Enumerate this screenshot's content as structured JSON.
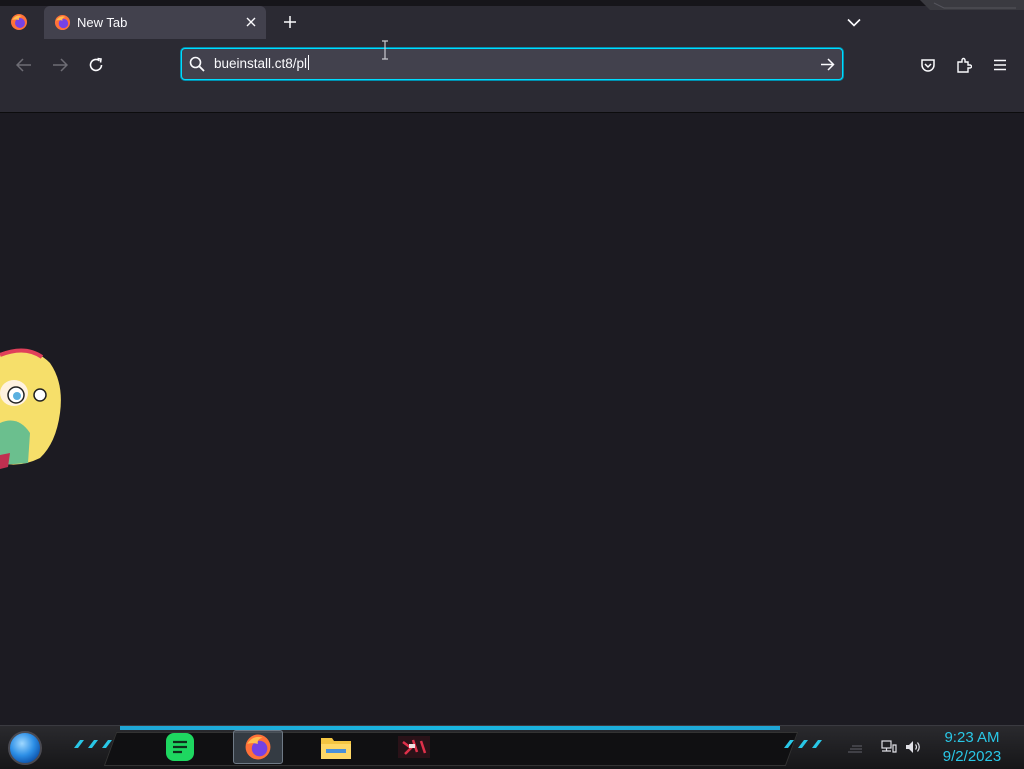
{
  "browser": {
    "tab_title": "New Tab",
    "url_value": "bueinstall.ct8/pl",
    "icons": {
      "firefox": "firefox-icon",
      "close": "close-icon",
      "new_tab": "plus-icon",
      "tab_list": "chevron-down-icon",
      "back": "arrow-left-icon",
      "forward": "arrow-right-icon",
      "reload": "reload-icon",
      "search": "search-icon",
      "go": "arrow-right-icon",
      "pocket": "pocket-icon",
      "extensions": "puzzle-icon",
      "menu": "hamburger-menu-icon"
    }
  },
  "taskbar": {
    "time": "9:23 AM",
    "date": "9/2/2023",
    "apps": [
      "notes-app-icon",
      "firefox-icon",
      "file-explorer-icon",
      "game-app-icon"
    ],
    "tray_icons": [
      "network-icon",
      "volume-icon"
    ]
  },
  "colors": {
    "accent": "#00ddff",
    "clock": "#29c7e6",
    "toolbar": "#2b2a33",
    "page": "#1c1b22"
  }
}
